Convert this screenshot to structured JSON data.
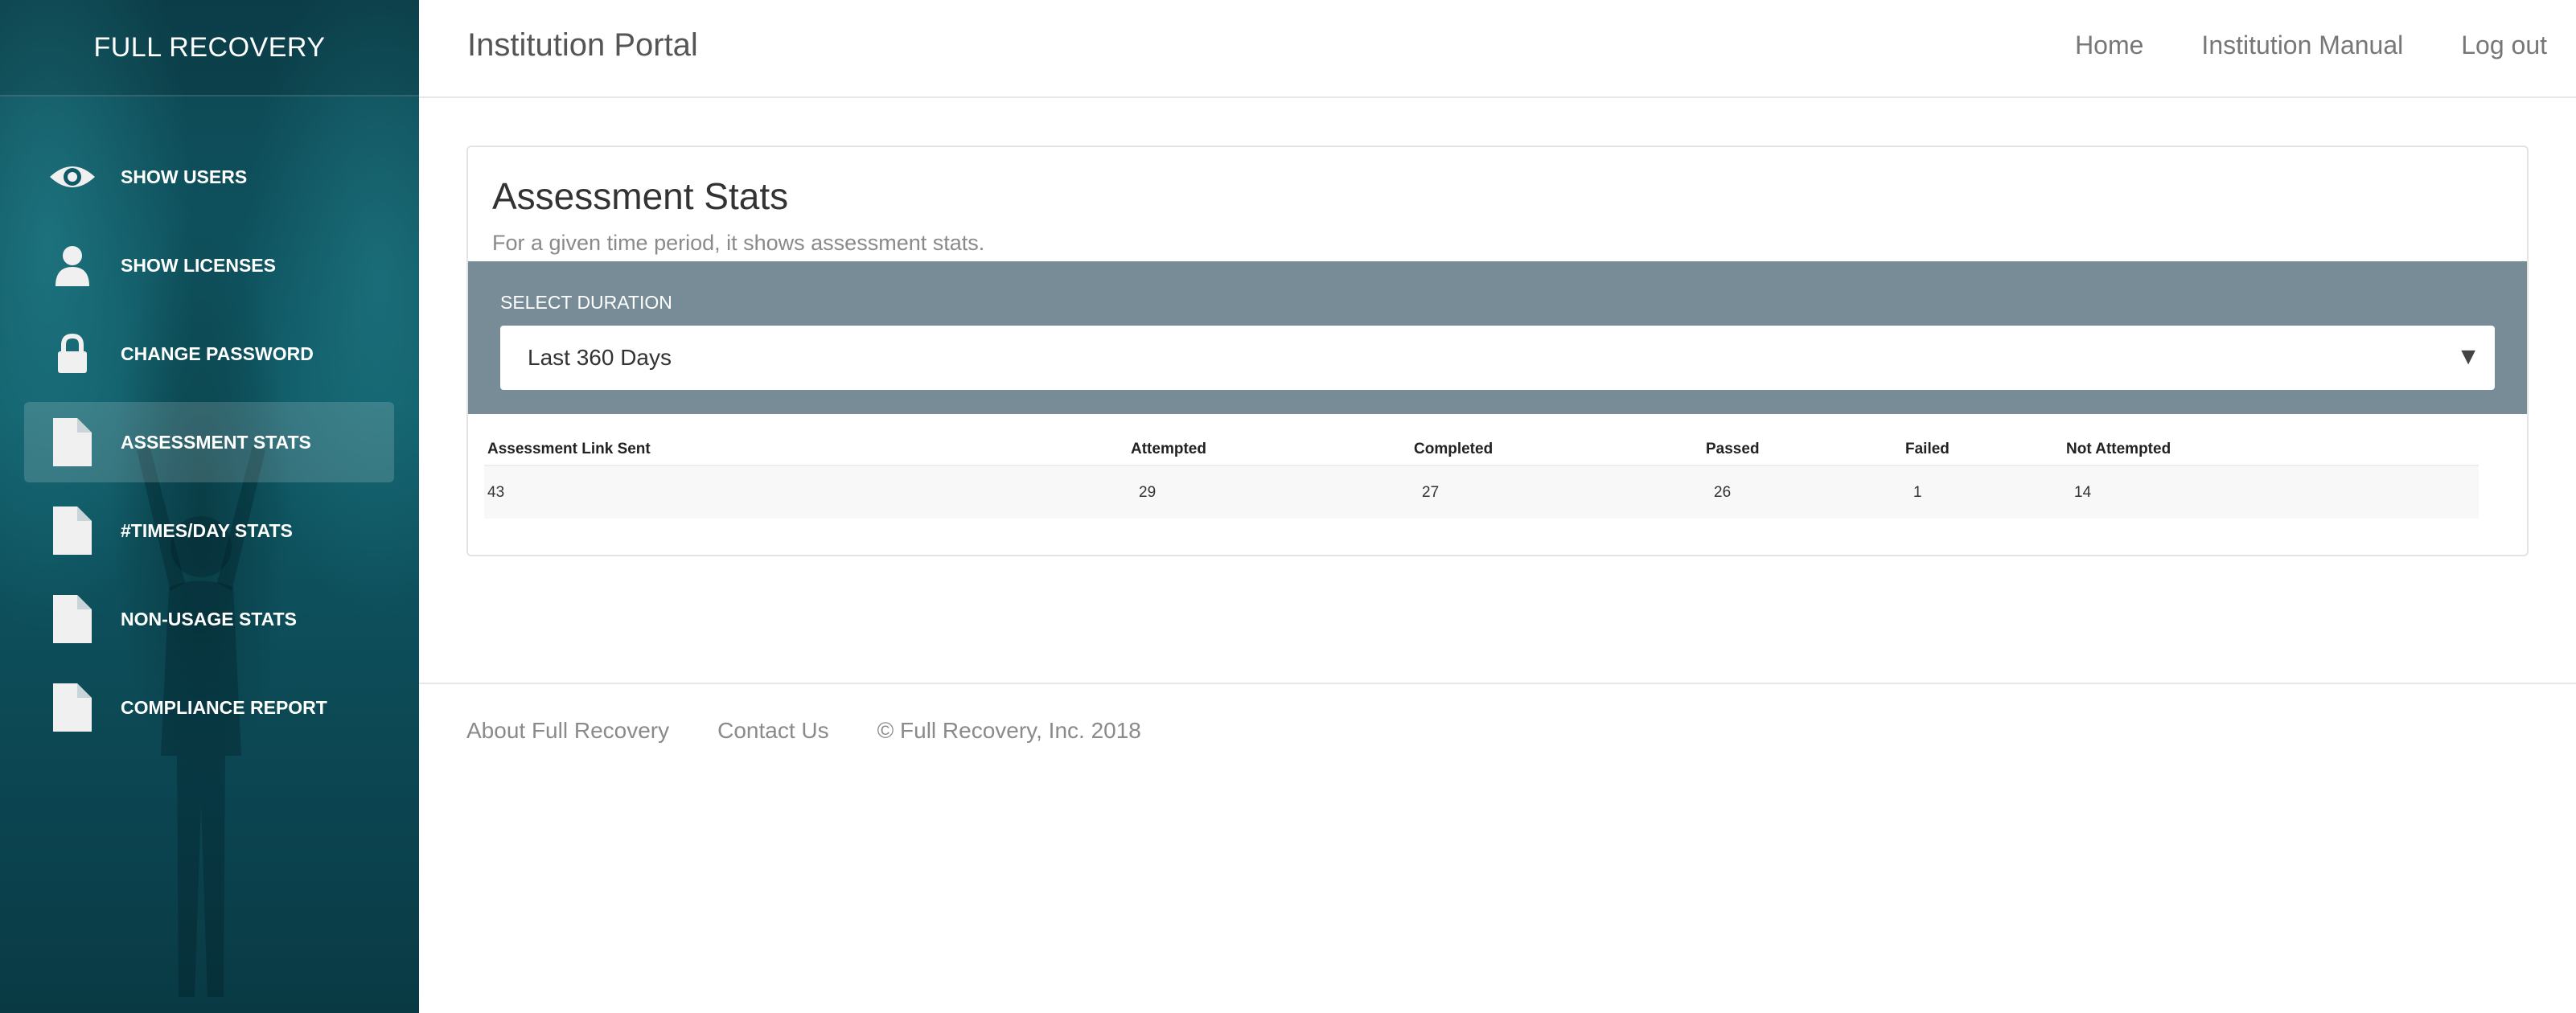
{
  "sidebar": {
    "brand": "FULL RECOVERY",
    "items": [
      {
        "label": "SHOW USERS",
        "icon": "eye-icon"
      },
      {
        "label": "SHOW LICENSES",
        "icon": "user-icon"
      },
      {
        "label": "CHANGE PASSWORD",
        "icon": "lock-icon"
      },
      {
        "label": "ASSESSMENT STATS",
        "icon": "document-icon",
        "active": true
      },
      {
        "label": "#TIMES/DAY STATS",
        "icon": "document-icon"
      },
      {
        "label": "NON-USAGE STATS",
        "icon": "document-icon"
      },
      {
        "label": "COMPLIANCE REPORT",
        "icon": "document-icon"
      }
    ]
  },
  "header": {
    "title": "Institution Portal",
    "nav": {
      "home": "Home",
      "manual": "Institution Manual",
      "logout": "Log out"
    }
  },
  "panel": {
    "title": "Assessment Stats",
    "subtitle": "For a given time period, it shows assessment stats.",
    "duration_label": "SELECT DURATION",
    "duration_value": "Last 360 Days",
    "duration_arrow": "▼"
  },
  "table": {
    "columns": [
      "Assessment Link Sent",
      "Attempted",
      "Completed",
      "Passed",
      "Failed",
      "Not Attempted"
    ],
    "rows": [
      [
        "43",
        "29",
        "27",
        "26",
        "1",
        "14"
      ]
    ]
  },
  "footer": {
    "about": "About Full Recovery",
    "contact": "Contact Us",
    "copyright": "© Full Recovery, Inc. 2018"
  },
  "colors": {
    "sidebar_bg": "#0d4652",
    "duration_bg": "#778c96",
    "active_item_bg": "rgba(255,255,255,0.16)"
  }
}
